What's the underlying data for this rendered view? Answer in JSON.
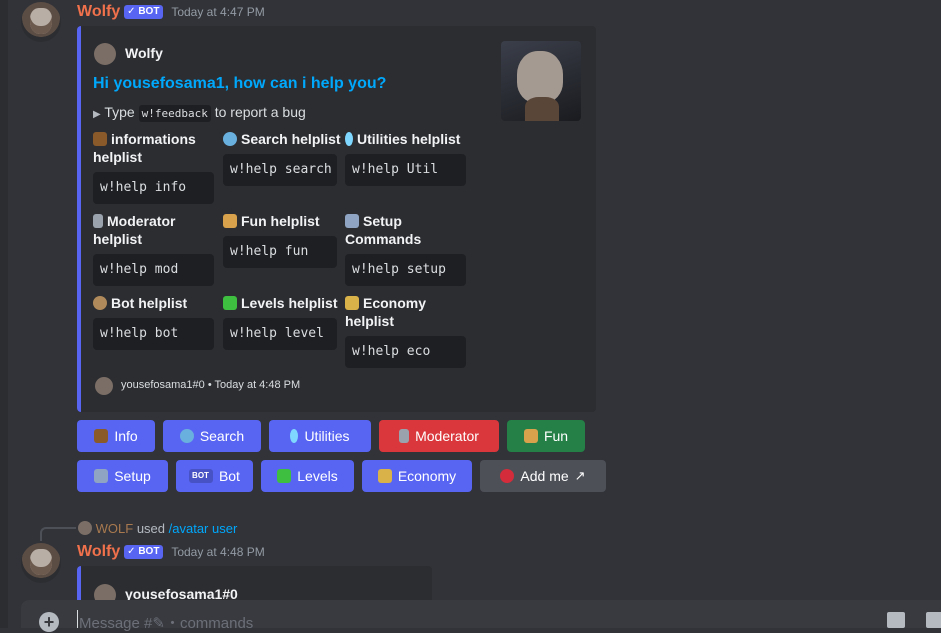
{
  "message1": {
    "author": "Wolfy",
    "bot_tag": "BOT",
    "timestamp": "Today at 4:47 PM",
    "embed": {
      "author_name": "Wolfy",
      "title": "Hi yousefosama1, how can i help you?",
      "desc_prefix": "Type",
      "desc_code": "w!feedback",
      "desc_suffix": "to report a bug",
      "fields": [
        {
          "name": "informations helplist",
          "value": "w!help info",
          "icon": "package-icon"
        },
        {
          "name": "Search helplist",
          "value": "w!help search",
          "icon": "magnifier-icon"
        },
        {
          "name": "Utilities helplist",
          "value": "w!help Util",
          "icon": "crystal-icon"
        },
        {
          "name": "Moderator helplist",
          "value": "w!help mod",
          "icon": "wrench-icon"
        },
        {
          "name": "Fun helplist",
          "value": "w!help fun",
          "icon": "puzzle-icon"
        },
        {
          "name": "Setup Commands",
          "value": "w!help setup",
          "icon": "tools-icon"
        },
        {
          "name": "Bot helplist",
          "value": "w!help bot",
          "icon": "coin-icon"
        },
        {
          "name": "Levels helplist",
          "value": "w!help level",
          "icon": "arrow-up-icon"
        },
        {
          "name": "Economy helplist",
          "value": "w!help eco",
          "icon": "money-icon"
        }
      ],
      "footer": "yousefosama1#0 • Today at 4:48 PM"
    },
    "buttons_row1": [
      {
        "label": "Info",
        "style": "blurple"
      },
      {
        "label": "Search",
        "style": "blurple"
      },
      {
        "label": "Utilities",
        "style": "blurple"
      },
      {
        "label": "Moderator",
        "style": "red"
      },
      {
        "label": "Fun",
        "style": "green"
      }
    ],
    "buttons_row2": [
      {
        "label": "Setup",
        "style": "blurple"
      },
      {
        "label": "Bot",
        "style": "blurple",
        "badge": "BOT"
      },
      {
        "label": "Levels",
        "style": "blurple"
      },
      {
        "label": "Economy",
        "style": "blurple"
      },
      {
        "label": "Add me",
        "style": "grey"
      }
    ]
  },
  "reply_line": {
    "user": "WOLF",
    "used": "used",
    "command": "/avatar user"
  },
  "message2": {
    "author": "Wolfy",
    "bot_tag": "BOT",
    "timestamp": "Today at 4:48 PM",
    "embed_author": "yousefosama1#0"
  },
  "composer": {
    "placeholder": "Message #✎・commands"
  },
  "colors": {
    "blurple": "#5865f2",
    "red": "#da373c",
    "green": "#248046",
    "grey": "#4e5058",
    "username": "#f0714b"
  }
}
